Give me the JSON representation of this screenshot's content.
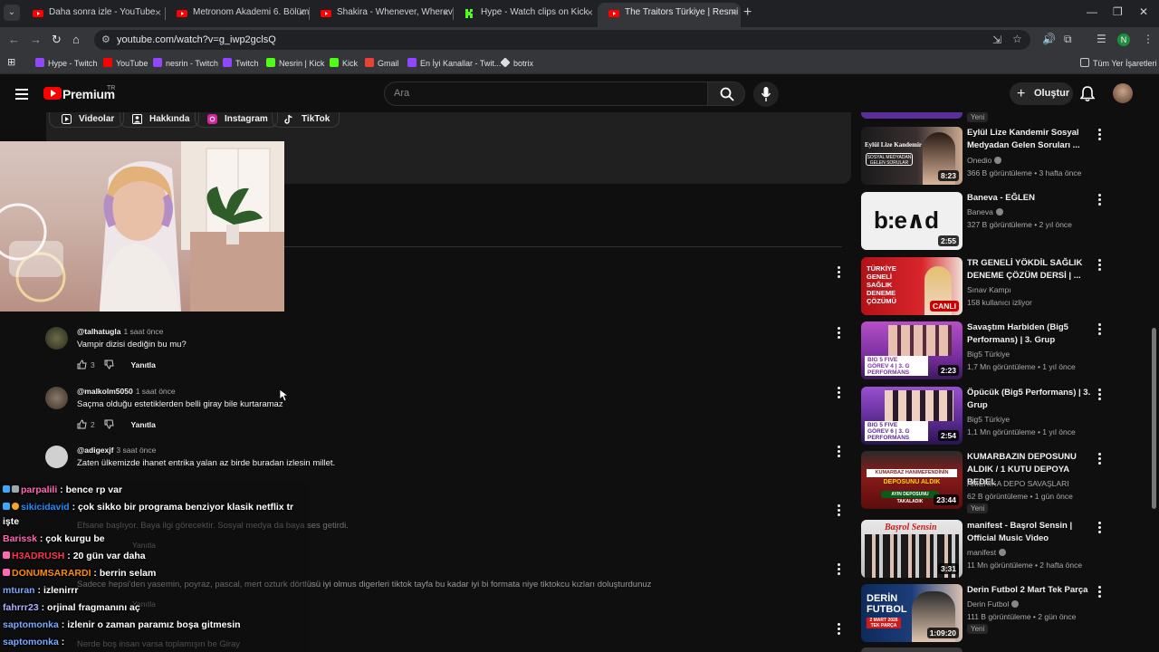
{
  "browser": {
    "tabs": [
      {
        "title": "Daha sonra izle - YouTube",
        "color": "#ff0000"
      },
      {
        "title": "Metronom Akademi 6. Bölüm ⁂",
        "color": "#ff0000"
      },
      {
        "title": "Shakira - Whenever, Wherever",
        "color": "#ff0000"
      },
      {
        "title": "Hype - Watch clips on Kick",
        "color": "#53fc18"
      },
      {
        "title": "The Traitors Türkiye | Resmi Fra",
        "color": "#ff0000"
      }
    ],
    "url": "youtube.com/watch?v=g_iwp2gclsQ",
    "profile_initial": "N",
    "bookmarks": [
      {
        "label": "Hype - Twitch",
        "color": "#9146ff"
      },
      {
        "label": "YouTube",
        "color": "#ff0000"
      },
      {
        "label": "nesrin - Twitch",
        "color": "#9146ff"
      },
      {
        "label": "Twitch",
        "color": "#9146ff"
      },
      {
        "label": "Nesrin | Kick",
        "color": "#53fc18"
      },
      {
        "label": "Kick",
        "color": "#53fc18"
      },
      {
        "label": "Gmail",
        "color": "#ea4335"
      },
      {
        "label": "En İyi Kanallar - Twit...",
        "color": "#9146ff"
      },
      {
        "label": "botrix",
        "color": "#dddddd"
      }
    ],
    "all_bookmarks": "Tüm Yer İşaretleri"
  },
  "youtube": {
    "brand": "Premium",
    "region": "TR",
    "search_placeholder": "Ara",
    "create_label": "Oluştur",
    "channel_links": [
      {
        "label": "Videolar",
        "icon": "video-icon"
      },
      {
        "label": "Hakkında",
        "icon": "person-icon"
      },
      {
        "label": "Instagram",
        "icon": "instagram-icon"
      },
      {
        "label": "TikTok",
        "icon": "tiktok-icon"
      }
    ]
  },
  "comments": [
    {
      "user": "@talhatugla",
      "time": "1 saat önce",
      "text": "Vampir dizisi dediğin bu mu?",
      "likes": "3",
      "reply": "Yanıtla"
    },
    {
      "user": "@malkolm5050",
      "time": "1 saat önce",
      "text": "Saçma olduğu estetiklerden belli giray bile kurtaramaz",
      "likes": "2",
      "reply": "Yanıtla"
    },
    {
      "user": "@adigexjf",
      "time": "3 saat önce",
      "text": "Zaten ülkemizde ihanet entrika yalan az birde buradan izlesin millet.",
      "likes": "",
      "reply": "Yanıtla"
    }
  ],
  "ghost_comments": [
    "Efsane başlıyor. Baya ilgi görecektir. Sosyal medya da baya ses getirdi.",
    "Yanıtla",
    "Sadece hepsi'den yasemin, poyraz, pascal, mert ozturk dörtlüsü iyi olmus digerleri tiktok tayfa bu kadar iyi bi formata niye tiktokcu kızları doluşturdunuz",
    "Yanıtla",
    "Nerde boş insan varsa toplamışın be Giray"
  ],
  "chat": [
    {
      "user": "parpalili",
      "msg": "bence rp var",
      "color": "#ff69b4"
    },
    {
      "user": "sikicidavid",
      "msg": "çok sikko bir programa benziyor klasik netflix tr",
      "color": "#1e90ff"
    },
    {
      "user": "işte",
      "msg": "",
      "color": "#ffffff"
    },
    {
      "user": "Barissk",
      "msg": "çok kurgu be",
      "color": "#ff69b4"
    },
    {
      "user": "H3ADRUSH",
      "msg": "20 gün var daha",
      "color": "#ff3355"
    },
    {
      "user": "DONUMSARARDI",
      "msg": "berrin selam",
      "color": "#ff8c00"
    },
    {
      "user": "mturan",
      "msg": "izlenirrr",
      "color": "#7aa7ff"
    },
    {
      "user": "fahrrr23",
      "msg": "orjinal fragmanını aç",
      "color": "#b0b0ff"
    },
    {
      "user": "saptomonka",
      "msg": "izlenir o zaman paramız boşa gitmesin",
      "color": "#7aa7ff"
    },
    {
      "user": "saptomonka",
      "msg": "",
      "color": "#7aa7ff"
    }
  ],
  "sidebar": {
    "top_new": "Yeni",
    "videos": [
      {
        "title": "Eylül Lize Kandemir Sosyal Medyadan Gelen Soruları ...",
        "channel": "Onedio",
        "verified": true,
        "meta": "366 B görüntüleme • 3 hafta önce",
        "duration": "8:23",
        "thumb": "#3a3a3a",
        "badge": ""
      },
      {
        "title": "Baneva - EĞLEN",
        "channel": "Baneva",
        "verified": true,
        "meta": "327 B görüntüleme • 2 yıl önce",
        "duration": "2:55",
        "thumb": "#e8e8e8",
        "badge": ""
      },
      {
        "title": "TR GENELİ YÖKDİL SAĞLIK DENEME ÇÖZÜM DERSİ | ...",
        "channel": "Sınav Kampı",
        "verified": false,
        "meta": "158 kullanıcı izliyor",
        "duration": "CANLI",
        "thumb": "#c4161c",
        "badge": ""
      },
      {
        "title": "Savaştım Harbiden (Big5 Performans) | 3. Grup",
        "channel": "Big5 Türkiye",
        "verified": false,
        "meta": "1,7 Mn görüntüleme • 1 yıl önce",
        "duration": "2:23",
        "thumb": "#8a3fa8",
        "badge": ""
      },
      {
        "title": "Öpücük (Big5 Performans) | 3. Grup",
        "channel": "Big5 Türkiye",
        "verified": false,
        "meta": "1,1 Mn görüntüleme • 1 yıl önce",
        "duration": "2:54",
        "thumb": "#6a2fa0",
        "badge": ""
      },
      {
        "title": "KUMARBAZIN DEPOSUNU ALDIK / 1 KUTU DEPOYA BEDEL",
        "channel": "AMERİKA DEPO SAVAŞLARI",
        "verified": false,
        "meta": "62 B görüntüleme • 1 gün önce",
        "duration": "23:44",
        "thumb": "#8b1a1a",
        "badge": "Yeni"
      },
      {
        "title": "manifest - Başrol Sensin | Official Music Video",
        "channel": "manifest",
        "verified": true,
        "meta": "11 Mn görüntüleme • 2 hafta önce",
        "duration": "3:31",
        "thumb": "#d8d8d8",
        "badge": ""
      },
      {
        "title": "Derin Futbol 2 Mart Tek Parça",
        "channel": "Derin Futbol",
        "verified": true,
        "meta": "111 B görüntüleme • 2 gün önce",
        "duration": "1:09:20",
        "thumb": "#1c3d7a",
        "badge": "Yeni"
      }
    ]
  }
}
